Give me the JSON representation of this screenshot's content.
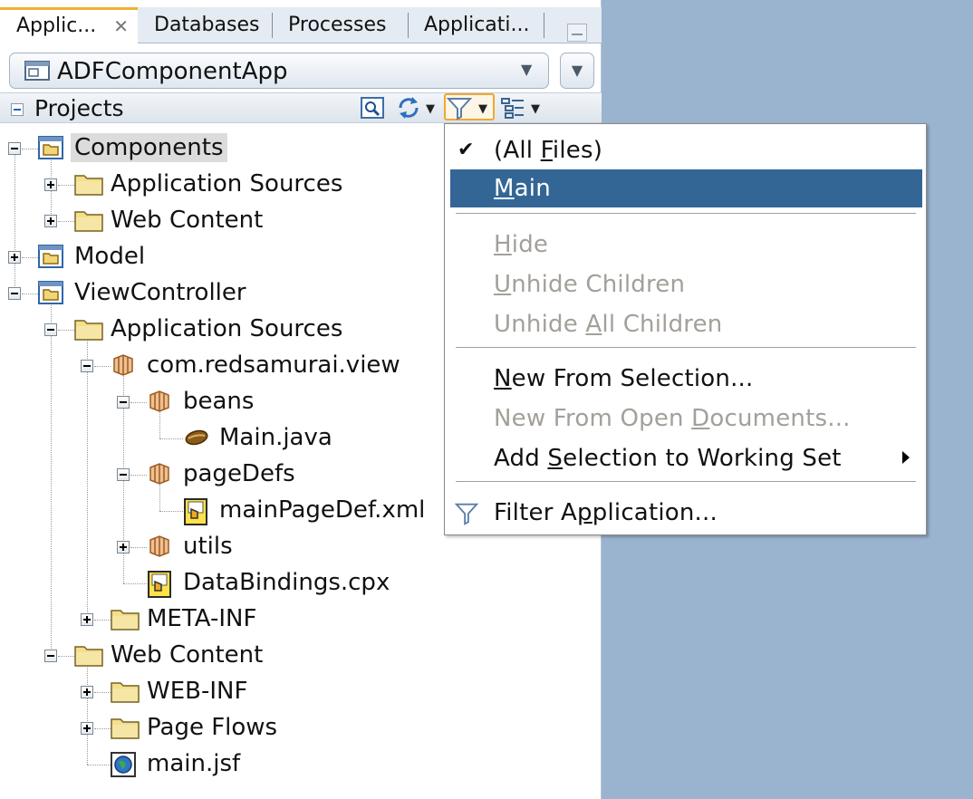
{
  "tabs": [
    {
      "label": "Applic...",
      "active": true,
      "closable": true
    },
    {
      "label": "Databases"
    },
    {
      "label": "Processes"
    },
    {
      "label": "Applicati..."
    }
  ],
  "app_selector": {
    "value": "ADFComponentApp"
  },
  "projects_header": {
    "label": "Projects"
  },
  "toolbar_icons": [
    "search-icon",
    "sync-icon",
    "filter-icon",
    "options-icon"
  ],
  "tree": [
    {
      "label": "Components",
      "icon": "project-icon",
      "expanded": true,
      "selected": true
    },
    {
      "label": "Application Sources",
      "icon": "folder-icon",
      "expanded": false
    },
    {
      "label": "Web Content",
      "icon": "folder-icon",
      "expanded": false
    },
    {
      "label": "Model",
      "icon": "project-icon",
      "expanded": false
    },
    {
      "label": "ViewController",
      "icon": "project-icon",
      "expanded": true
    },
    {
      "label": "Application Sources",
      "icon": "folder-icon",
      "expanded": true
    },
    {
      "label": "com.redsamurai.view",
      "icon": "package-icon",
      "expanded": true
    },
    {
      "label": "beans",
      "icon": "package-icon",
      "expanded": true
    },
    {
      "label": "Main.java",
      "icon": "java-bean-icon"
    },
    {
      "label": "pageDefs",
      "icon": "package-icon",
      "expanded": true
    },
    {
      "label": "mainPageDef.xml",
      "icon": "pagedef-file-icon"
    },
    {
      "label": "utils",
      "icon": "package-icon",
      "expanded": false
    },
    {
      "label": "DataBindings.cpx",
      "icon": "pagedef-file-icon"
    },
    {
      "label": "META-INF",
      "icon": "folder-icon",
      "expanded": false
    },
    {
      "label": "Web Content",
      "icon": "folder-icon",
      "expanded": true
    },
    {
      "label": "WEB-INF",
      "icon": "folder-icon",
      "expanded": false
    },
    {
      "label": "Page Flows",
      "icon": "folder-icon",
      "expanded": false
    },
    {
      "label": "main.jsf",
      "icon": "web-page-icon"
    }
  ],
  "menu": {
    "all_files": {
      "before": "(All ",
      "mnemonic": "F",
      "after": "iles)",
      "checked": true
    },
    "main": {
      "before": "",
      "mnemonic": "M",
      "after": "ain",
      "highlighted": true
    },
    "hide": {
      "before": "",
      "mnemonic": "H",
      "after": "ide",
      "disabled": true
    },
    "unhide_children": {
      "before": "",
      "mnemonic": "U",
      "after": "nhide Children",
      "disabled": true
    },
    "unhide_all_children": {
      "before": "Unhide ",
      "mnemonic": "A",
      "after": "ll Children",
      "disabled": true
    },
    "new_from_selection": {
      "before": "",
      "mnemonic": "N",
      "after": "ew From Selection...",
      "disabled": false
    },
    "new_from_open_documents": {
      "before": "New From Open ",
      "mnemonic": "D",
      "after": "ocuments...",
      "disabled": true
    },
    "add_selection": {
      "before": "Add ",
      "mnemonic": "S",
      "after": "election to Working Set",
      "submenu": true
    },
    "filter_application": {
      "before": "Filter A",
      "mnemonic": "p",
      "after": "plication...",
      "icon": "filter-icon"
    }
  },
  "colors": {
    "background": "#9ab3cf",
    "menu_highlight": "#346695",
    "active_tab_accent": "#f0b030",
    "disabled_text": "#a3a09a"
  }
}
